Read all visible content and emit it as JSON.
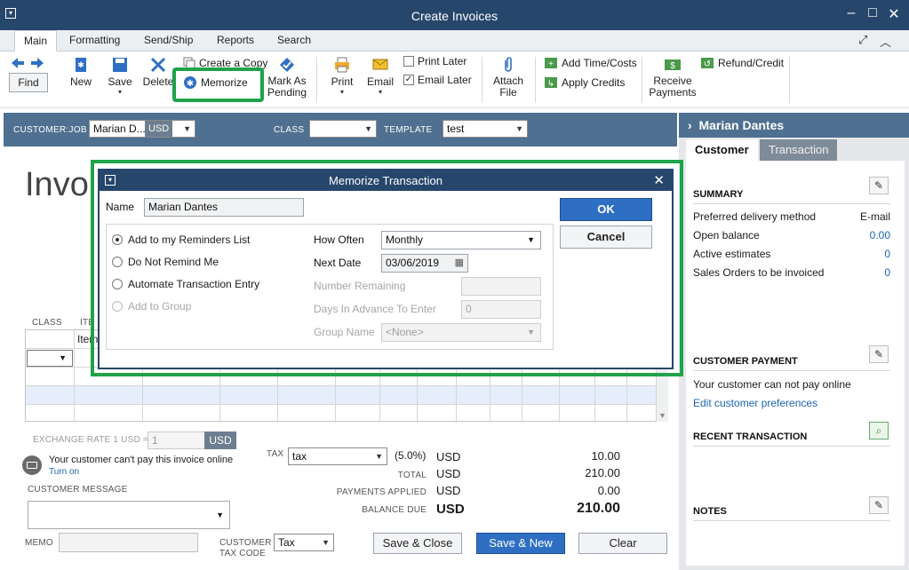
{
  "window": {
    "title": "Create Invoices"
  },
  "tabs": [
    "Main",
    "Formatting",
    "Send/Ship",
    "Reports",
    "Search"
  ],
  "toolbar": {
    "find": "Find",
    "new": "New",
    "save": "Save",
    "delete": "Delete",
    "create_copy": "Create a Copy",
    "memorize": "Memorize",
    "mark_as_pending_1": "Mark As",
    "mark_as_pending_2": "Pending",
    "print": "Print",
    "email": "Email",
    "print_later": "Print Later",
    "email_later": "Email Later",
    "attach_file_1": "Attach",
    "attach_file_2": "File",
    "add_time_costs": "Add Time/Costs",
    "apply_credits": "Apply Credits",
    "receive_payments_1": "Receive",
    "receive_payments_2": "Payments",
    "refund_credit": "Refund/Credit"
  },
  "header": {
    "customer_job_label": "CUSTOMER:JOB",
    "customer_value": "Marian D...",
    "currency": "USD",
    "class_label": "CLASS",
    "template_label": "TEMPLATE",
    "template_value": "test"
  },
  "form": {
    "title_partial": "Invoi",
    "class_col": "CLASS",
    "item_col": "ITE",
    "item_header": "Item",
    "exchange_rate_label": "EXCHANGE RATE 1 USD =",
    "exchange_rate_value": "1",
    "exchange_currency": "USD",
    "cant_pay_text": "Your customer can't pay this invoice online",
    "turn_on": "Turn on",
    "customer_message_label": "CUSTOMER MESSAGE",
    "memo_label": "MEMO",
    "customer_tax_code_label_1": "CUSTOMER",
    "customer_tax_code_label_2": "TAX CODE",
    "customer_tax_code_value": "Tax",
    "tax_label": "TAX",
    "tax_value": "tax",
    "tax_rate": "(5.0%)",
    "tax_currency": "USD",
    "tax_amount": "10.00",
    "total_label": "TOTAL",
    "total_currency": "USD",
    "total_amount": "210.00",
    "payments_label": "PAYMENTS APPLIED",
    "payments_currency": "USD",
    "payments_amount": "0.00",
    "balance_label": "BALANCE DUE",
    "balance_currency": "USD",
    "balance_amount": "210.00",
    "save_close": "Save & Close",
    "save_new": "Save & New",
    "clear": "Clear"
  },
  "panel": {
    "customer_name": "Marian Dantes",
    "tab_customer": "Customer",
    "tab_transaction": "Transaction",
    "summary_title": "SUMMARY",
    "summary_rows": [
      {
        "label": "Preferred delivery method",
        "value": "E-mail"
      },
      {
        "label": "Open balance",
        "value": "0.00"
      },
      {
        "label": "Active estimates",
        "value": "0"
      },
      {
        "label": "Sales Orders to be invoiced",
        "value": "0"
      }
    ],
    "customer_payment_title": "CUSTOMER PAYMENT",
    "cannot_pay_online": "Your customer can not pay online",
    "edit_prefs": "Edit customer preferences",
    "recent_transaction_title": "RECENT TRANSACTION",
    "notes_title": "NOTES"
  },
  "dialog": {
    "title": "Memorize Transaction",
    "name_label": "Name",
    "name_value": "Marian Dantes",
    "ok": "OK",
    "cancel": "Cancel",
    "options": [
      {
        "label": "Add to my Reminders List",
        "selected": true,
        "disabled": false
      },
      {
        "label": "Do Not Remind Me",
        "selected": false,
        "disabled": false
      },
      {
        "label": "Automate Transaction Entry",
        "selected": false,
        "disabled": false
      },
      {
        "label": "Add to Group",
        "selected": false,
        "disabled": true
      }
    ],
    "how_often_label": "How Often",
    "how_often_value": "Monthly",
    "next_date_label": "Next Date",
    "next_date_value": "03/06/2019",
    "number_remaining_label": "Number Remaining",
    "days_in_advance_label": "Days In Advance To Enter",
    "days_in_advance_value": "0",
    "group_name_label": "Group Name",
    "group_name_value": "<None>"
  },
  "colors": {
    "title_bar": "#27466c",
    "header_bar": "#4f7090",
    "highlight": "#1fa34a",
    "primary_button": "#2f6fc3",
    "link": "#1d64b3"
  }
}
